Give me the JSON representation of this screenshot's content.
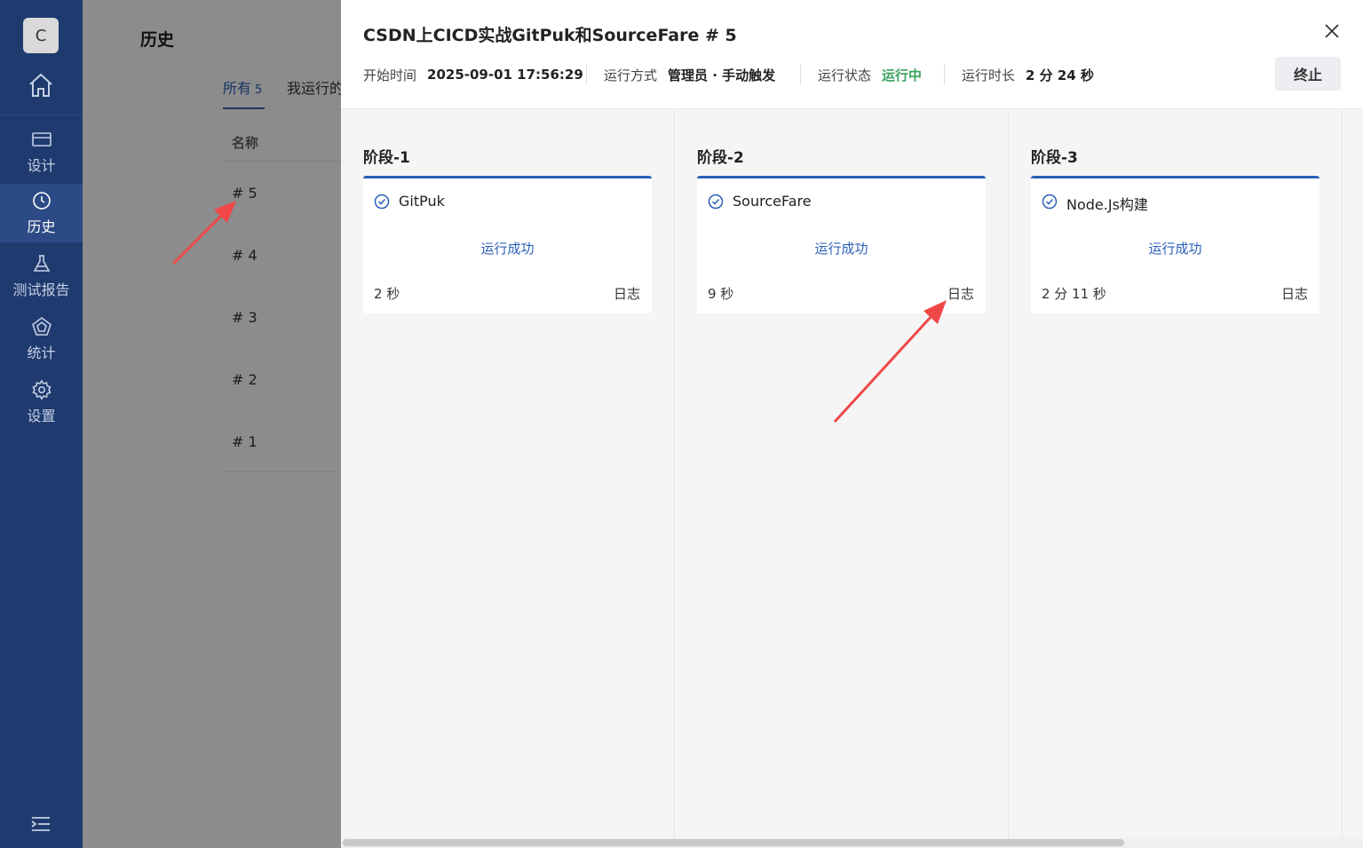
{
  "sidebar": {
    "avatar_letter": "C",
    "items": [
      {
        "label": "设计",
        "icon": "credit-card-icon"
      },
      {
        "label": "历史",
        "icon": "clock-icon",
        "active": true
      },
      {
        "label": "测试报告",
        "icon": "flask-icon"
      },
      {
        "label": "统计",
        "icon": "pentagon-icon"
      },
      {
        "label": "设置",
        "icon": "gear-icon"
      }
    ]
  },
  "history_page": {
    "title": "历史",
    "tabs": [
      {
        "label": "所有",
        "count": "5"
      },
      {
        "label": "我运行的"
      }
    ],
    "column_header": "名称",
    "rows": [
      "# 5",
      "# 4",
      "# 3",
      "# 2",
      "# 1"
    ]
  },
  "drawer": {
    "title": "CSDN上CICD实战GitPuk和SourceFare # 5",
    "meta": {
      "start_label": "开始时间",
      "start_value": "2025-09-01 17:56:29",
      "mode_label": "运行方式",
      "mode_value": "管理员 · 手动触发",
      "state_label": "运行状态",
      "state_value": "运行中",
      "duration_label": "运行时长",
      "duration_value": "2 分 24 秒"
    },
    "stop_label": "终止",
    "stages": [
      {
        "title": "阶段-1",
        "task": {
          "name": "GitPuk",
          "status": "运行成功",
          "duration": "2 秒",
          "log": "日志"
        }
      },
      {
        "title": "阶段-2",
        "task": {
          "name": "SourceFare",
          "status": "运行成功",
          "duration": "9 秒",
          "log": "日志"
        }
      },
      {
        "title": "阶段-3",
        "task": {
          "name": "Node.Js构建",
          "status": "运行成功",
          "duration": "2 分 11 秒",
          "log": "日志"
        }
      }
    ]
  },
  "colors": {
    "sidebar_bg": "#1f3a6e",
    "accent": "#2a5fb8",
    "running_green": "#3aa35c",
    "annotation_arrow": "#f04848"
  }
}
